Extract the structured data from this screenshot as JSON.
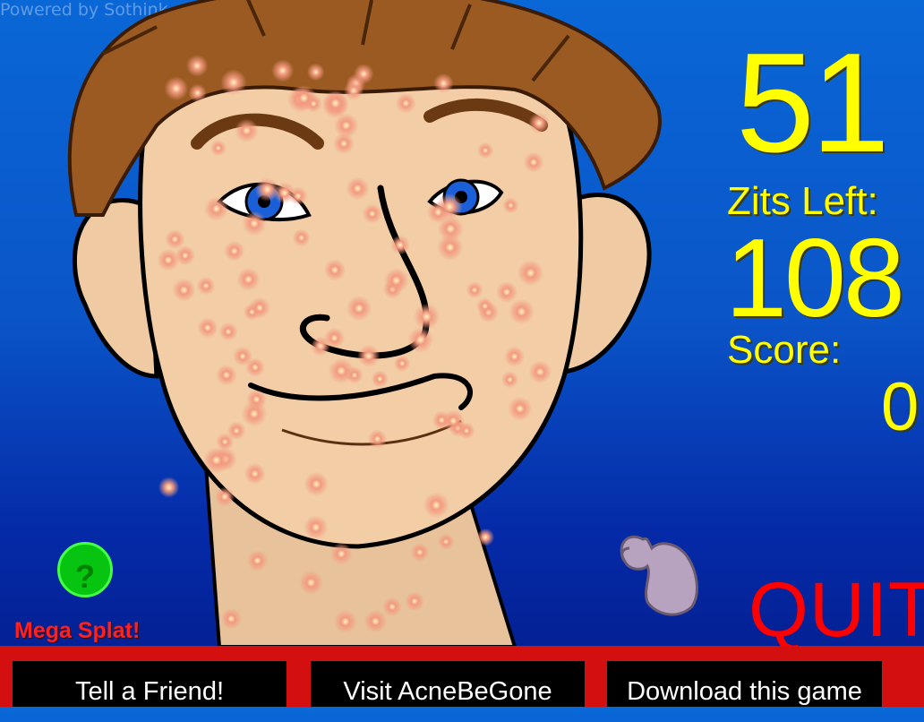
{
  "watermark": "Powered by Sothink",
  "hud": {
    "timer": "51",
    "zits_left_label": "Zits Left:",
    "zits_left": "108",
    "score_label": "Score:",
    "score": "0",
    "quit": "QUIT"
  },
  "help": {
    "icon": "question-icon",
    "glyph": "?",
    "label": "Mega Splat!"
  },
  "buttons": [
    {
      "label": "Tell a Friend!"
    },
    {
      "label": "Visit AcneBeGone"
    },
    {
      "label": "Download this game"
    }
  ],
  "colors": {
    "hud_text": "#ffff00",
    "quit": "#ff0000",
    "bottom_bar": "#d30f0f",
    "help_circle": "#06c40f"
  }
}
